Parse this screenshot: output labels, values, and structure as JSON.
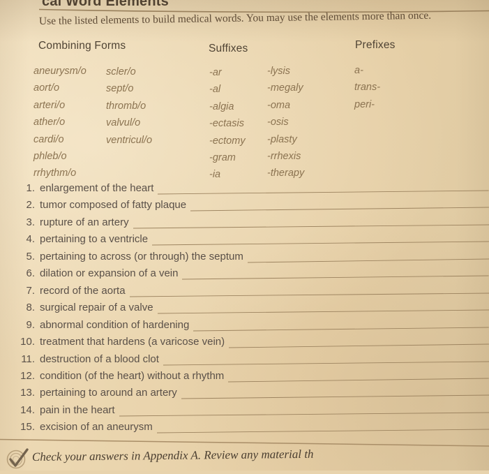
{
  "page": {
    "title": "cal Word Elements",
    "instructions": "Use the listed elements to build medical words. You may use the elements more than once."
  },
  "colors": {
    "paper": "#e8d3ad",
    "heading_text": "#4a3d2f",
    "body_text": "#5a5048",
    "word_list_text": "#8b7351",
    "rule_line": "#9d8460"
  },
  "element_table": {
    "headers": {
      "combining_forms": "Combining Forms",
      "suffixes": "Suffixes",
      "prefixes": "Prefixes"
    },
    "combining_forms_col1": [
      "aneurysm/o",
      "aort/o",
      "arteri/o",
      "ather/o",
      "cardi/o",
      "phleb/o",
      "rrhythm/o"
    ],
    "combining_forms_col2": [
      "scler/o",
      "sept/o",
      "thromb/o",
      "valvul/o",
      "ventricul/o"
    ],
    "suffixes_col1": [
      "-ar",
      "-al",
      "-algia",
      "-ectasis",
      "-ectomy",
      "-gram",
      "-ia"
    ],
    "suffixes_col2": [
      "-lysis",
      "-megaly",
      "-oma",
      "-osis",
      "-plasty",
      "-rrhexis",
      "-therapy"
    ],
    "prefixes_col1": [
      "a-",
      "trans-",
      "peri-"
    ]
  },
  "exercise_items": [
    {
      "number": "1.",
      "text": "enlargement of the heart",
      "answer": ""
    },
    {
      "number": "2.",
      "text": "tumor composed of fatty plaque",
      "answer": ""
    },
    {
      "number": "3.",
      "text": "rupture of an artery",
      "answer": ""
    },
    {
      "number": "4.",
      "text": "pertaining to a ventricle",
      "answer": ""
    },
    {
      "number": "5.",
      "text": "pertaining to across (or through) the septum",
      "answer": ""
    },
    {
      "number": "6.",
      "text": "dilation or expansion of a vein",
      "answer": ""
    },
    {
      "number": "7.",
      "text": "record of the aorta",
      "answer": ""
    },
    {
      "number": "8.",
      "text": "surgical repair of a valve",
      "answer": ""
    },
    {
      "number": "9.",
      "text": "abnormal condition of hardening",
      "answer": ""
    },
    {
      "number": "10.",
      "text": "treatment that hardens (a varicose vein)",
      "answer": ""
    },
    {
      "number": "11.",
      "text": "destruction of a blood clot",
      "answer": ""
    },
    {
      "number": "12.",
      "text": "condition (of the heart) without a rhythm",
      "answer": ""
    },
    {
      "number": "13.",
      "text": "pertaining to around an artery",
      "answer": ""
    },
    {
      "number": "14.",
      "text": "pain in the heart",
      "answer": ""
    },
    {
      "number": "15.",
      "text": "excision of an aneurysm",
      "answer": ""
    }
  ],
  "footer": {
    "icon": "check-circle-icon",
    "note": "Check your answers in Appendix A. Review any material th"
  }
}
